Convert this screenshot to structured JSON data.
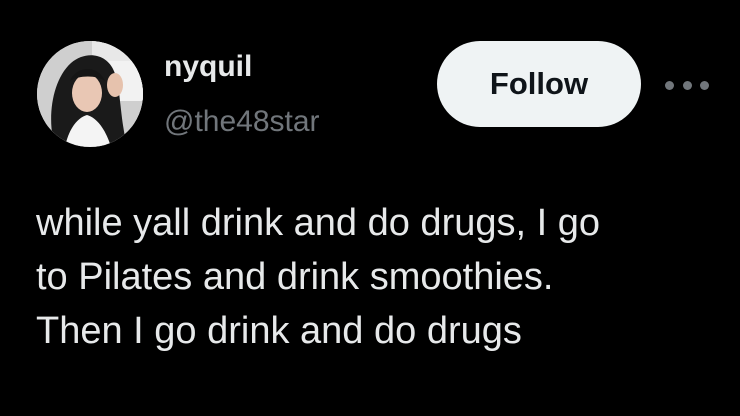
{
  "user": {
    "display_name": "nyquil",
    "handle": "@the48star"
  },
  "actions": {
    "follow_label": "Follow",
    "more_icon": "more-horizontal-icon"
  },
  "tweet": {
    "lines": [
      "while yall drink and do drugs, I go",
      "to Pilates and drink smoothies.",
      "Then I go drink and do drugs"
    ]
  },
  "colors": {
    "background": "#000000",
    "primary_text": "#e7e9ea",
    "secondary_text": "#71767b",
    "follow_button_bg": "#eff3f4",
    "follow_button_text": "#0f1419"
  }
}
